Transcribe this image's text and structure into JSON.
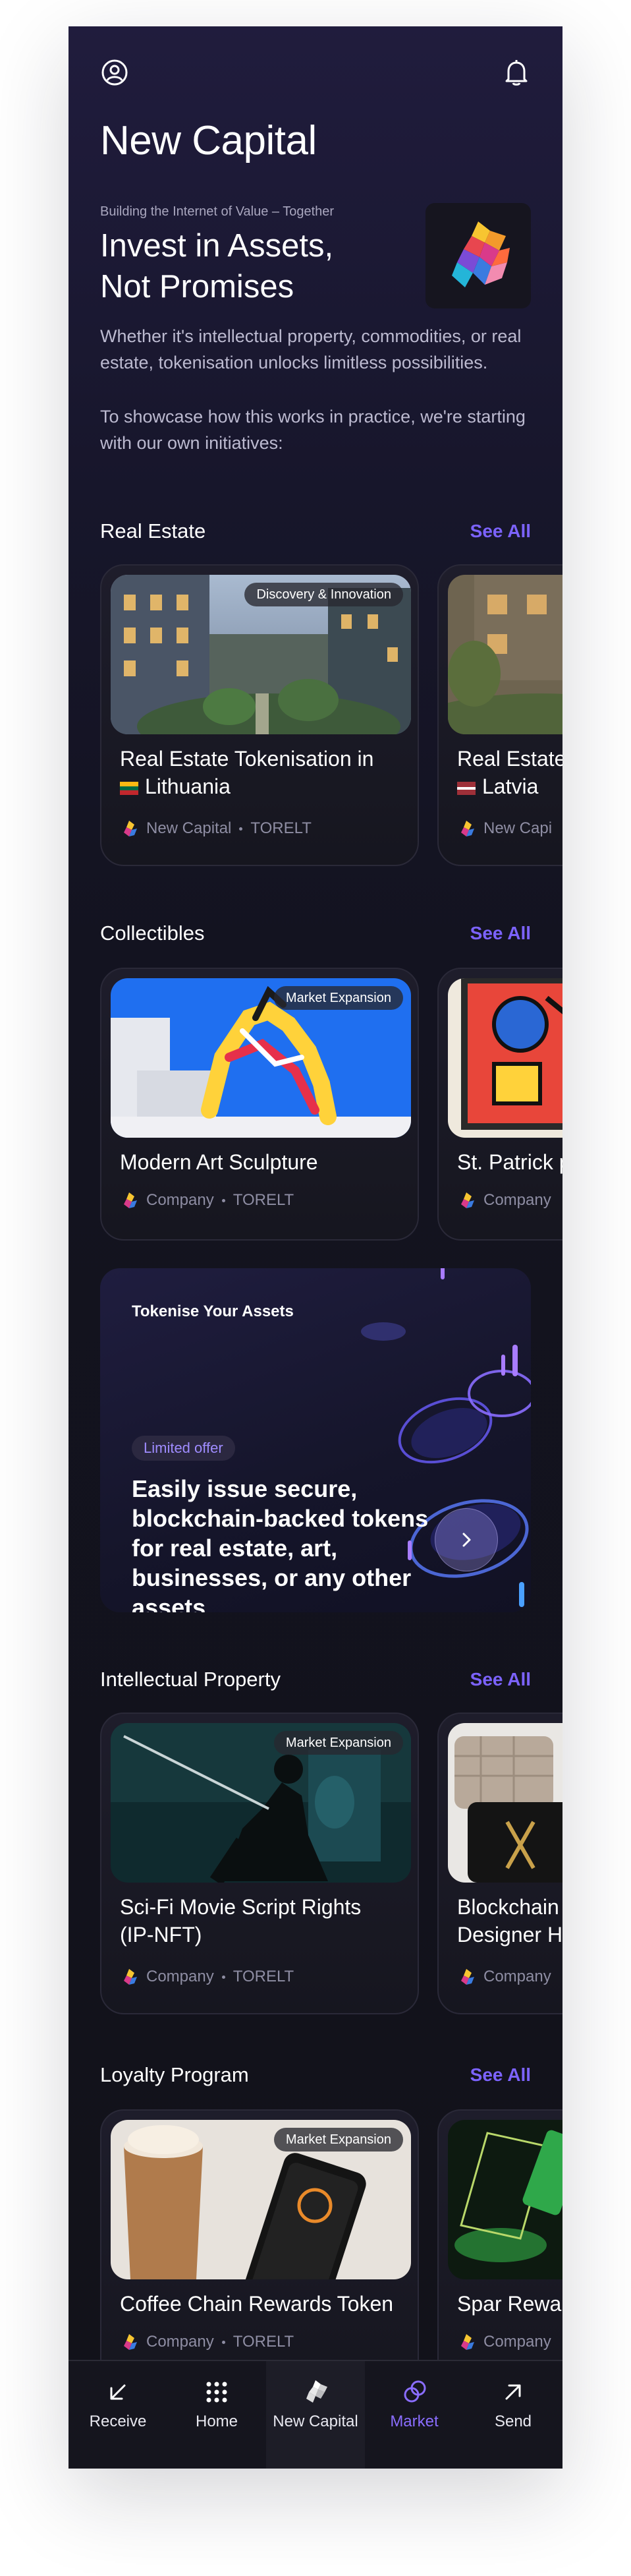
{
  "app": {
    "title": "New Capital"
  },
  "header": {
    "profile_icon": "user-circle-icon",
    "notifications_icon": "bell-icon"
  },
  "hero": {
    "kicker": "Building the Internet of Value – Together",
    "heading_line1": "Invest in Assets,",
    "heading_line2": "Not Promises",
    "paragraph1": "Whether it's intellectual property, commodities, or real estate, tokenisation unlocks limitless possibilities.",
    "paragraph2": "To showcase how this works in practice, we're starting with our own initiatives:",
    "logo_icon": "lion-logo-icon"
  },
  "sections": {
    "real_estate": {
      "title": "Real Estate",
      "see_all": "See All",
      "cards": [
        {
          "badge": "Discovery & Innovation",
          "title": "Real Estate Tokenisation in",
          "title_line2": "Lithuania",
          "flag": "lithuania-flag-icon",
          "company": "New Capital",
          "ticker": "TORELT"
        },
        {
          "title": "Real Estate",
          "title_line2": "Latvia",
          "flag": "latvia-flag-icon",
          "company": "New Capi"
        }
      ]
    },
    "collectibles": {
      "title": "Collectibles",
      "see_all": "See All",
      "cards": [
        {
          "badge": "Market Expansion",
          "title": "Modern Art Sculpture",
          "company": "Company",
          "ticker": "TORELT"
        },
        {
          "title": "St. Patrick p",
          "company": "Company"
        }
      ]
    },
    "intellectual_property": {
      "title": "Intellectual Property",
      "see_all": "See All",
      "cards": [
        {
          "badge": "Market Expansion",
          "title": "Sci-Fi Movie Script Rights",
          "title_line2": "(IP-NFT)",
          "company": "Company",
          "ticker": "TORELT"
        },
        {
          "title": "Blockchain",
          "title_line2": "Designer H",
          "company": "Company"
        }
      ]
    },
    "loyalty_program": {
      "title": "Loyalty Program",
      "see_all": "See All",
      "cards": [
        {
          "badge": "Market Expansion",
          "title": "Coffee Chain Rewards Token",
          "company": "Company",
          "ticker": "TORELT"
        },
        {
          "title": "Spar Rewar",
          "company": "Company"
        }
      ]
    }
  },
  "promo": {
    "kicker": "Tokenise Your Assets",
    "pill": "Limited offer",
    "text": "Easily issue secure, blockchain-backed tokens for real estate, art, businesses, or any other assets",
    "button_icon": "chevron-right-icon"
  },
  "tabbar": {
    "active": "Market",
    "items": [
      {
        "label": "Receive",
        "icon": "arrow-down-left-icon"
      },
      {
        "label": "Home",
        "icon": "grid-dots-icon"
      },
      {
        "label": "New Capital",
        "icon": "lion-logo-icon"
      },
      {
        "label": "Market",
        "icon": "market-rings-icon"
      },
      {
        "label": "Send",
        "icon": "arrow-up-right-icon"
      }
    ]
  },
  "colors": {
    "accent": "#7c63ff",
    "background": "#17162b",
    "card": "#1e1d2b",
    "muted_text": "#8e8da3"
  }
}
